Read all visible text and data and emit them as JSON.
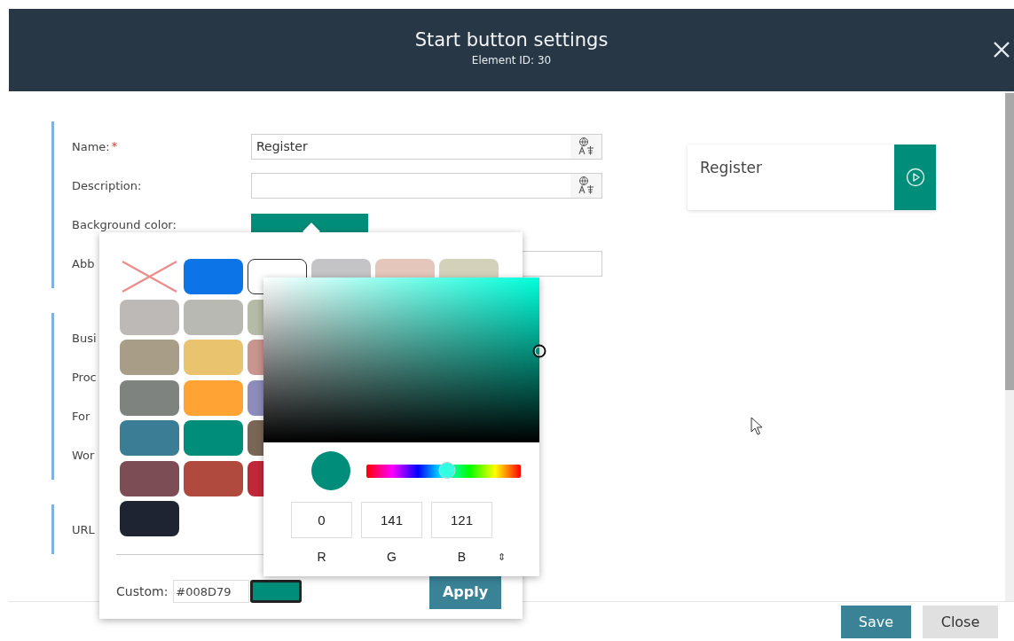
{
  "dialog": {
    "title": "Start button settings",
    "subtitle": "Element ID: 30"
  },
  "sections": [
    {
      "rows": [
        {
          "kind": "text",
          "label": "Name:",
          "required": true,
          "value": "Register",
          "translate": true
        },
        {
          "kind": "text",
          "label": "Description:",
          "required": false,
          "translate": true
        },
        {
          "kind": "color",
          "label": "Background color:",
          "required": false,
          "color": "#008d79"
        },
        {
          "kind": "text",
          "label": "Abb",
          "required": false,
          "translate": false
        }
      ]
    },
    {
      "rows": [
        {
          "kind": "label",
          "label": "Busi"
        },
        {
          "kind": "label",
          "label": "Proc"
        },
        {
          "kind": "label",
          "label": "For"
        },
        {
          "kind": "label",
          "label": "Wor"
        }
      ]
    },
    {
      "rows": [
        {
          "kind": "label",
          "label": "URL"
        }
      ]
    }
  ],
  "preview": {
    "label": "Register",
    "color": "#008d79"
  },
  "palette": {
    "rows": [
      {
        "swatches": [
          {
            "kind": "none",
            "selected": false
          },
          {
            "kind": "color",
            "color": "#0d74e8",
            "selected": false
          },
          {
            "kind": "color",
            "color": "#ffffff",
            "selected": true
          },
          {
            "kind": "color",
            "color": "#c4c4c6",
            "selected": false
          },
          {
            "kind": "color",
            "color": "#e5c6bb",
            "selected": false
          },
          {
            "kind": "color",
            "color": "#d4d1ba",
            "selected": false
          }
        ]
      },
      {
        "swatches": [
          {
            "kind": "color",
            "color": "#bdb9b6",
            "selected": false
          },
          {
            "kind": "color",
            "color": "#b9b9b4",
            "selected": false
          },
          {
            "kind": "color",
            "color": "#b5bba7",
            "selected": false
          }
        ]
      },
      {
        "swatches": [
          {
            "kind": "color",
            "color": "#a89d87",
            "selected": false
          },
          {
            "kind": "color",
            "color": "#e9c36d",
            "selected": false
          },
          {
            "kind": "color",
            "color": "#c9958f",
            "selected": false
          }
        ]
      },
      {
        "swatches": [
          {
            "kind": "color",
            "color": "#7e837f",
            "selected": false
          },
          {
            "kind": "color",
            "color": "#ffa434",
            "selected": false
          },
          {
            "kind": "color",
            "color": "#8e8cba",
            "selected": false
          }
        ]
      },
      {
        "swatches": [
          {
            "kind": "color",
            "color": "#3c7d96",
            "selected": false
          },
          {
            "kind": "color",
            "color": "#008d79",
            "selected": false
          },
          {
            "kind": "color",
            "color": "#7a6655",
            "selected": false
          }
        ]
      },
      {
        "swatches": [
          {
            "kind": "color",
            "color": "#7d4d56",
            "selected": false
          },
          {
            "kind": "color",
            "color": "#b04a3f",
            "selected": false
          },
          {
            "kind": "color",
            "color": "#c0283a",
            "selected": false
          }
        ]
      },
      {
        "swatches": [
          {
            "kind": "color",
            "color": "#1f2433",
            "selected": false
          }
        ]
      }
    ],
    "custom": {
      "label": "Custom:",
      "value": "#008D79",
      "color": "#008d79"
    },
    "apply": "Apply"
  },
  "picker": {
    "color": "#008d79",
    "channels": [
      {
        "value": "0",
        "label": "R"
      },
      {
        "value": "141",
        "label": "G"
      },
      {
        "value": "121",
        "label": "B"
      }
    ],
    "mode_toggle": "⇕"
  },
  "footer": {
    "buttons": [
      {
        "label": "Save",
        "kind": "primary"
      },
      {
        "label": "Close",
        "kind": "secondary"
      }
    ]
  }
}
